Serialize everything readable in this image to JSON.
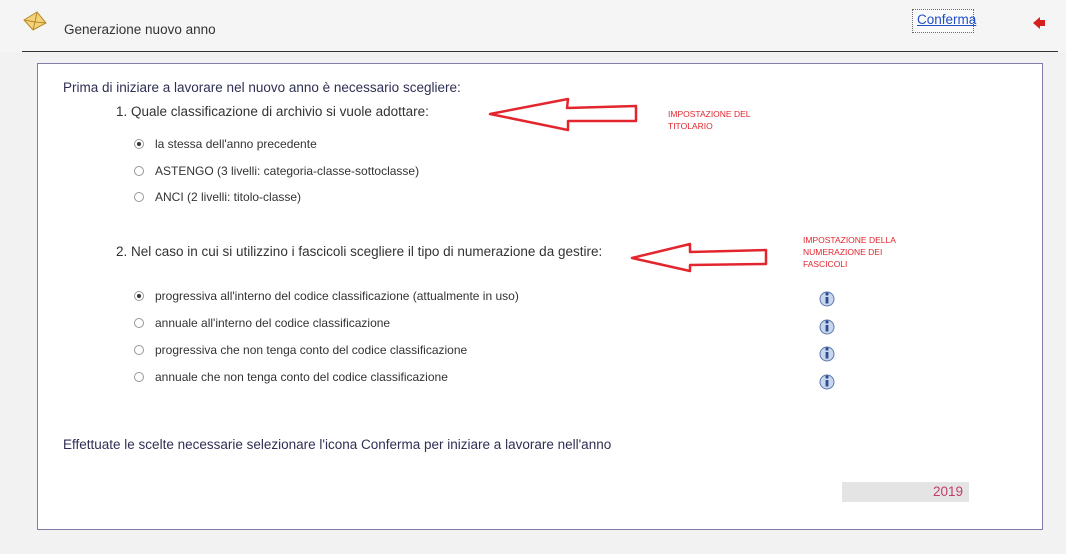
{
  "header": {
    "title": "Generazione nuovo anno",
    "confirm_label": "Conferma"
  },
  "intro": "Prima di iniziare a lavorare nel nuovo anno è necessario scegliere:",
  "section1": {
    "question": "1. Quale classificazione di archivio si vuole adottare:",
    "options": [
      {
        "label": "la stessa dell'anno precedente",
        "checked": true
      },
      {
        "label": "ASTENGO (3 livelli: categoria-classe-sottoclasse)",
        "checked": false
      },
      {
        "label": "ANCI (2 livelli: titolo-classe)",
        "checked": false
      }
    ]
  },
  "section2": {
    "question": "2. Nel caso in cui si utilizzino i fascicoli scegliere il tipo di numerazione da gestire:",
    "options": [
      {
        "label": "progressiva all'interno del codice classificazione (attualmente in uso)",
        "checked": true
      },
      {
        "label": "annuale all'interno del codice classificazione",
        "checked": false
      },
      {
        "label": "progressiva che non tenga conto del codice classificazione",
        "checked": false
      },
      {
        "label": "annuale che non tenga conto del codice classificazione",
        "checked": false
      }
    ]
  },
  "footer_text": "Effettuate le scelte necessarie selezionare l'icona Conferma per iniziare a lavorare nell'anno",
  "year": "2019",
  "annotations": {
    "titolario": [
      "IMPOSTAZIONE DEL",
      "TITOLARIO"
    ],
    "numerazione": [
      "IMPOSTAZIONE DELLA",
      "NUMERAZIONE DEI",
      "FASCICOLI"
    ]
  },
  "colors": {
    "annotation": "#e3262e",
    "link": "#1f4fc4",
    "year": "#c33b6a"
  }
}
